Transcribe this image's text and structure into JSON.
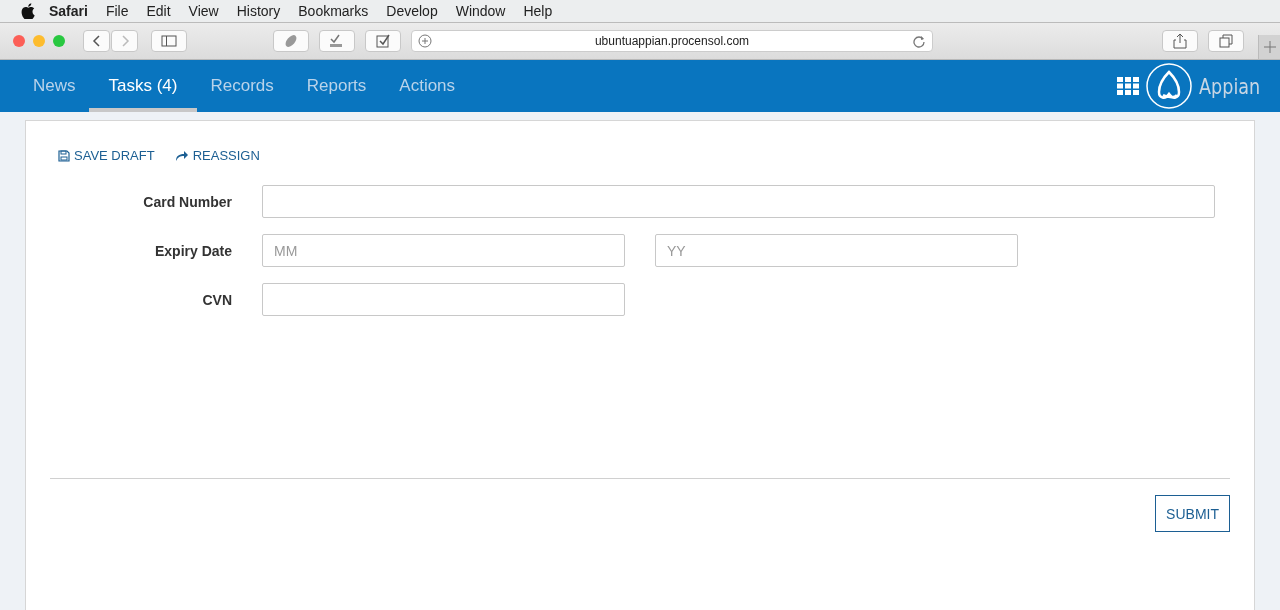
{
  "menu_bar": {
    "app": "Safari",
    "items": [
      "File",
      "Edit",
      "View",
      "History",
      "Bookmarks",
      "Develop",
      "Window",
      "Help"
    ]
  },
  "browser": {
    "url": "ubuntuappian.procensol.com"
  },
  "nav": {
    "tabs": [
      {
        "label": "News",
        "selected": false
      },
      {
        "label": "Tasks (4)",
        "selected": true
      },
      {
        "label": "Records",
        "selected": false
      },
      {
        "label": "Reports",
        "selected": false
      },
      {
        "label": "Actions",
        "selected": false
      }
    ],
    "brand": "Appian"
  },
  "actions": [
    {
      "kind": "save",
      "label": "SAVE DRAFT"
    },
    {
      "kind": "reassign",
      "label": "REASSIGN"
    }
  ],
  "form": [
    {
      "label": "Card Number",
      "inputs": [
        {
          "kind": "wide"
        }
      ]
    },
    {
      "label": "Expiry Date",
      "inputs": [
        {
          "kind": "half",
          "placeholder": "MM"
        },
        {
          "kind": "half",
          "placeholder": "YY"
        }
      ]
    },
    {
      "label": "CVN",
      "inputs": [
        {
          "kind": "half"
        }
      ]
    }
  ],
  "submit": "SUBMIT"
}
